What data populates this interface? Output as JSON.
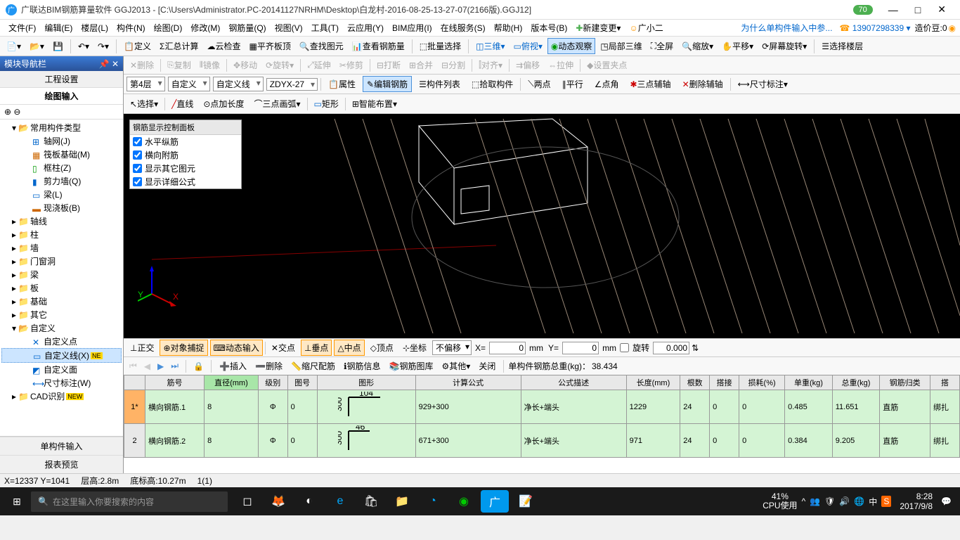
{
  "title": "广联达BIM钢筋算量软件 GGJ2013 - [C:\\Users\\Administrator.PC-20141127NRHM\\Desktop\\白龙村-2016-08-25-13-27-07(2166版).GGJ12]",
  "badge_70": "70",
  "menus": [
    "文件(F)",
    "编辑(E)",
    "楼层(L)",
    "构件(N)",
    "绘图(D)",
    "修改(M)",
    "钢筋量(Q)",
    "视图(V)",
    "工具(T)",
    "云应用(Y)",
    "BIM应用(I)",
    "在线服务(S)",
    "帮助(H)",
    "版本号(B)"
  ],
  "menu_right": {
    "new_change": "新建变更",
    "user_icon": "广小二",
    "hint": "为什么单构件输入中参...",
    "phone": "13907298339",
    "cost_bean": "造价豆:0"
  },
  "toolbar1": {
    "define": "定义",
    "sum": "汇总计算",
    "cloud": "云检查",
    "slab": "平齐板顶",
    "find": "查找图元",
    "rebar": "查看钢筋量",
    "batch": "批量选择",
    "d3": "三维",
    "over": "俯视",
    "dyn": "动态观察",
    "local3d": "局部三维",
    "full": "全屏",
    "zoom": "缩放",
    "pan": "平移",
    "screen": "屏幕旋转",
    "floor": "选择楼层"
  },
  "edit_bar": {
    "del": "删除",
    "copy": "复制",
    "mirror": "镜像",
    "move": "移动",
    "rotate": "旋转",
    "extend": "延伸",
    "trim": "修剪",
    "break": "打断",
    "merge": "合并",
    "split": "分割",
    "align": "对齐",
    "offset": "偏移",
    "stretch": "拉伸",
    "setpt": "设置夹点"
  },
  "prop_bar": {
    "floor": "第4层",
    "comp": "自定义",
    "line": "自定义线",
    "code": "ZDYX-27",
    "prop": "属性",
    "edit_rebar": "编辑钢筋",
    "list": "构件列表",
    "pick": "拾取构件",
    "two": "两点",
    "parallel": "平行",
    "angle": "点角",
    "three_aux": "三点辅轴",
    "del_aux": "删除辅轴",
    "dim": "尺寸标注"
  },
  "draw_bar": {
    "select": "选择",
    "line": "直线",
    "ptlen": "点加长度",
    "arc3": "三点画弧",
    "rect": "矩形",
    "smart": "智能布置"
  },
  "rebar_panel": {
    "title": "钢筋显示控制面板",
    "opts": [
      "水平纵筋",
      "横向附筋",
      "显示其它图元",
      "显示详细公式"
    ]
  },
  "snap_bar": {
    "ortho": "正交",
    "osnap": "对象捕捉",
    "dyn": "动态输入",
    "inter": "交点",
    "perp": "垂点",
    "mid": "中点",
    "apex": "顶点",
    "coord": "坐标",
    "noofs": "不偏移",
    "x": "X=",
    "xval": "0",
    "mm": "mm",
    "y": "Y=",
    "yval": "0",
    "rot": "旋转",
    "rotval": "0.000"
  },
  "table_bar": {
    "insert": "插入",
    "delete": "删除",
    "ruler": "缩尺配筋",
    "info": "钢筋信息",
    "lib": "钢筋图库",
    "other": "其他",
    "close": "关闭",
    "total_label": "单构件钢筋总重(kg)：",
    "total": "38.434"
  },
  "columns": [
    "",
    "筋号",
    "直径(mm)",
    "级别",
    "图号",
    "图形",
    "计算公式",
    "公式描述",
    "长度(mm)",
    "根数",
    "搭接",
    "损耗(%)",
    "单重(kg)",
    "总重(kg)",
    "钢筋归类",
    "搭"
  ],
  "rows": [
    {
      "n": "1*",
      "name": "横向钢筋.1",
      "dia": "8",
      "grade": "Φ",
      "code": "0",
      "shape_a": "300",
      "shape_b": "104",
      "formula": "929+300",
      "desc": "净长+端头",
      "len": "1229",
      "qty": "24",
      "lap": "0",
      "loss": "0",
      "uw": "0.485",
      "tw": "11.651",
      "cat": "直筋",
      "j": "绑扎"
    },
    {
      "n": "2",
      "name": "横向钢筋.2",
      "dia": "8",
      "grade": "Φ",
      "code": "0",
      "shape_a": "300",
      "shape_b": "46",
      "formula": "671+300",
      "desc": "净长+端头",
      "len": "971",
      "qty": "24",
      "lap": "0",
      "loss": "0",
      "uw": "0.384",
      "tw": "9.205",
      "cat": "直筋",
      "j": "绑扎"
    }
  ],
  "sidebar": {
    "header": "模块导航栏",
    "tab_proj": "工程设置",
    "tab_draw": "绘图输入",
    "common": "常用构件类型",
    "common_items": [
      "轴网(J)",
      "筏板基础(M)",
      "框柱(Z)",
      "剪力墙(Q)",
      "梁(L)",
      "现浇板(B)"
    ],
    "folders": [
      "轴线",
      "柱",
      "墙",
      "门窗洞",
      "梁",
      "板",
      "基础",
      "其它"
    ],
    "custom": "自定义",
    "custom_items": [
      "自定义点",
      "自定义线(X)",
      "自定义面",
      "尺寸标注(W)"
    ],
    "cad": "CAD识别",
    "bottom_single": "单构件输入",
    "bottom_report": "报表预览"
  },
  "status": {
    "xy": "X=12337 Y=1041",
    "fh": "层高:2.8m",
    "bh": "底标高:10.27m",
    "sel": "1(1)"
  },
  "taskbar": {
    "search": "在这里输入你要搜索的内容",
    "cpu_pct": "41%",
    "cpu_lbl": "CPU使用",
    "time": "8:28",
    "date": "2017/9/8",
    "ime": "中"
  }
}
